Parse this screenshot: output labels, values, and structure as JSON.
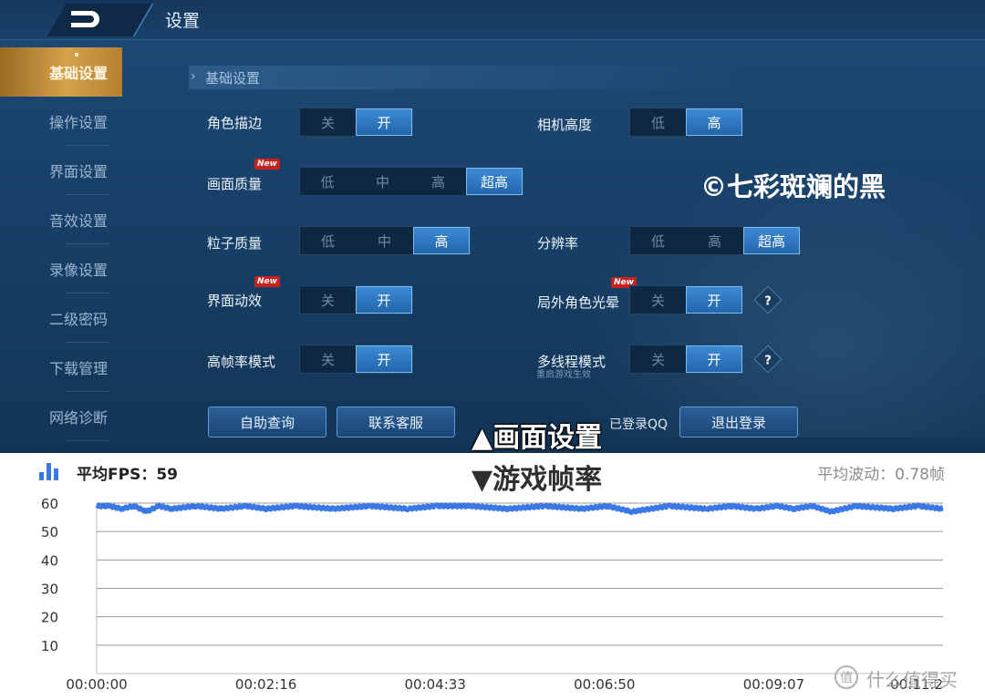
{
  "game": {
    "title": "设置",
    "sidebar": [
      {
        "label": "基础设置",
        "active": true
      },
      {
        "label": "操作设置",
        "active": false
      },
      {
        "label": "界面设置",
        "active": false
      },
      {
        "label": "音效设置",
        "active": false
      },
      {
        "label": "录像设置",
        "active": false
      },
      {
        "label": "二级密码",
        "active": false
      },
      {
        "label": "下载管理",
        "active": false
      },
      {
        "label": "网络诊断",
        "active": false
      }
    ],
    "section_title": "基础设置",
    "settings": {
      "outline": {
        "label": "角色描边",
        "options": [
          "关",
          "开"
        ],
        "selected": 1
      },
      "camera": {
        "label": "相机高度",
        "options": [
          "低",
          "高"
        ],
        "selected": 1
      },
      "quality": {
        "label": "画面质量",
        "new": "New",
        "options": [
          "低",
          "中",
          "高",
          "超高"
        ],
        "selected": 3
      },
      "particle": {
        "label": "粒子质量",
        "options": [
          "低",
          "中",
          "高"
        ],
        "selected": 2
      },
      "resolution": {
        "label": "分辨率",
        "options": [
          "低",
          "高",
          "超高"
        ],
        "selected": 2
      },
      "ui_anim": {
        "label": "界面动效",
        "new": "New",
        "options": [
          "关",
          "开"
        ],
        "selected": 1
      },
      "halo": {
        "label": "局外角色光晕",
        "new": "New",
        "options": [
          "关",
          "开"
        ],
        "selected": 1
      },
      "high_fps": {
        "label": "高帧率模式",
        "options": [
          "关",
          "开"
        ],
        "selected": 1
      },
      "multithread": {
        "label": "多线程模式",
        "options": [
          "关",
          "开"
        ],
        "selected": 1
      }
    },
    "help_glyph": "?",
    "restart_hint": "重启游戏生效",
    "buttons": {
      "self_help": "自助查询",
      "contact": "联系客服",
      "logout": "退出登录"
    },
    "qq_status": "已登录QQ",
    "watermark": "©七彩斑斓的黑"
  },
  "captions": {
    "top": "▲画面设置",
    "bottom": "▼游戏帧率"
  },
  "fps": {
    "title": "平均FPS：59",
    "fluctuation": "平均波动：0.78帧",
    "icon": "bar-chart-icon",
    "line_color": "#3a78e6"
  },
  "brand": {
    "text": "什么值得买",
    "icon": "smzdm-logo"
  },
  "chart_data": {
    "type": "line",
    "title": "",
    "xlabel": "",
    "ylabel": "",
    "ylim": [
      0,
      60
    ],
    "yticks": [
      10,
      20,
      30,
      40,
      50,
      60
    ],
    "xticks": [
      "00:00:00",
      "00:02:16",
      "00:04:33",
      "00:06:50",
      "00:09:07",
      "00:11:2"
    ],
    "x_range_seconds": [
      0,
      680
    ],
    "grid": true,
    "series": [
      {
        "values_approx": "nearly constant around 59 fps, small dips to ~56-58",
        "x_seconds": [
          0,
          10,
          20,
          30,
          40,
          50,
          60,
          80,
          100,
          120,
          136,
          160,
          190,
          220,
          250,
          273,
          300,
          330,
          360,
          390,
          410,
          430,
          460,
          490,
          510,
          530,
          547,
          560,
          575,
          590,
          610,
          640,
          660,
          680
        ],
        "y": [
          59,
          59,
          58,
          59,
          57,
          59,
          58,
          59,
          58,
          59,
          58,
          59,
          58,
          59,
          58,
          59,
          59,
          58,
          59,
          58,
          59,
          57,
          59,
          58,
          59,
          58,
          59,
          58,
          59,
          57,
          59,
          58,
          59,
          58
        ]
      }
    ]
  }
}
